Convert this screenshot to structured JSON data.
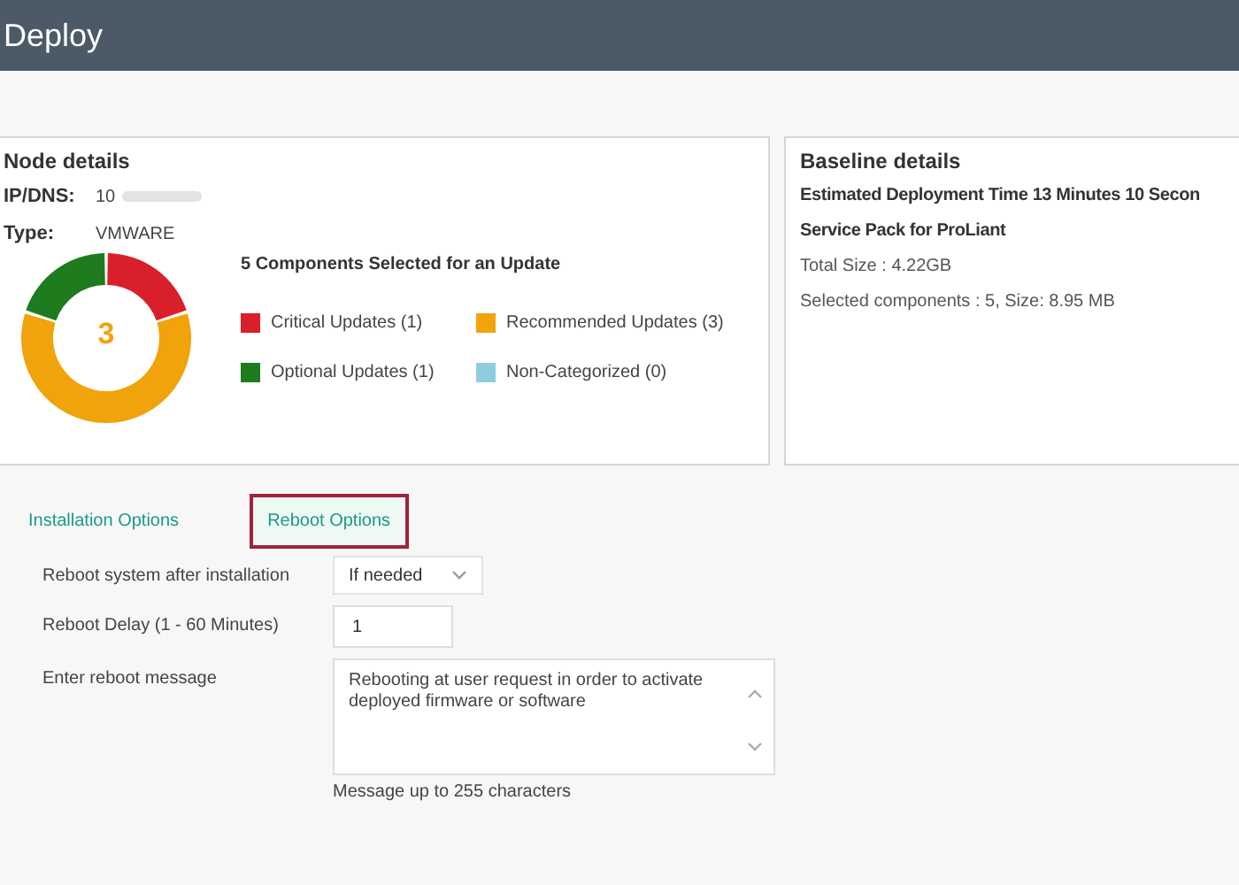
{
  "header": {
    "title": "Deploy"
  },
  "node_details": {
    "title": "Node details",
    "ip_label": "IP/DNS:",
    "ip_value": "10",
    "ip_redacted": true,
    "type_label": "Type:",
    "type_value": "VMWARE",
    "donut_center": "3",
    "chart_data": {
      "type": "donut",
      "title": "5 Components Selected for an Update",
      "legend": "right",
      "categories": [
        "Critical Updates (1)",
        "Recommended Updates (3)",
        "Optional Updates (1)",
        "Non-Categorized (0)"
      ],
      "values": [
        1,
        3,
        1,
        0
      ],
      "colors": [
        "#d9202a",
        "#f0a30a",
        "#1e7b1e",
        "#8ecde0"
      ]
    }
  },
  "baseline_details": {
    "title": "Baseline details",
    "lines": [
      {
        "text": "Estimated Deployment Time 13 Minutes 10 Secon",
        "bold": true
      },
      {
        "text": "Service Pack for ProLiant",
        "bold": true
      },
      {
        "text": "Total Size : 4.22GB",
        "bold": false
      },
      {
        "text": "Selected components : 5, Size: 8.95 MB",
        "bold": false
      }
    ]
  },
  "tabs": [
    {
      "label": "Installation Options",
      "selected": false
    },
    {
      "label": "Reboot Options",
      "selected": true
    }
  ],
  "form": [
    {
      "kind": "select",
      "label": "Reboot system after installation",
      "value": "If needed"
    },
    {
      "kind": "input",
      "label": "Reboot Delay (1 - 60 Minutes)",
      "value": "1"
    },
    {
      "kind": "textarea",
      "label": "Enter reboot message",
      "value": "Rebooting at user request in order to activate deployed firmware or software",
      "hint": "Message up to 255 characters"
    }
  ]
}
